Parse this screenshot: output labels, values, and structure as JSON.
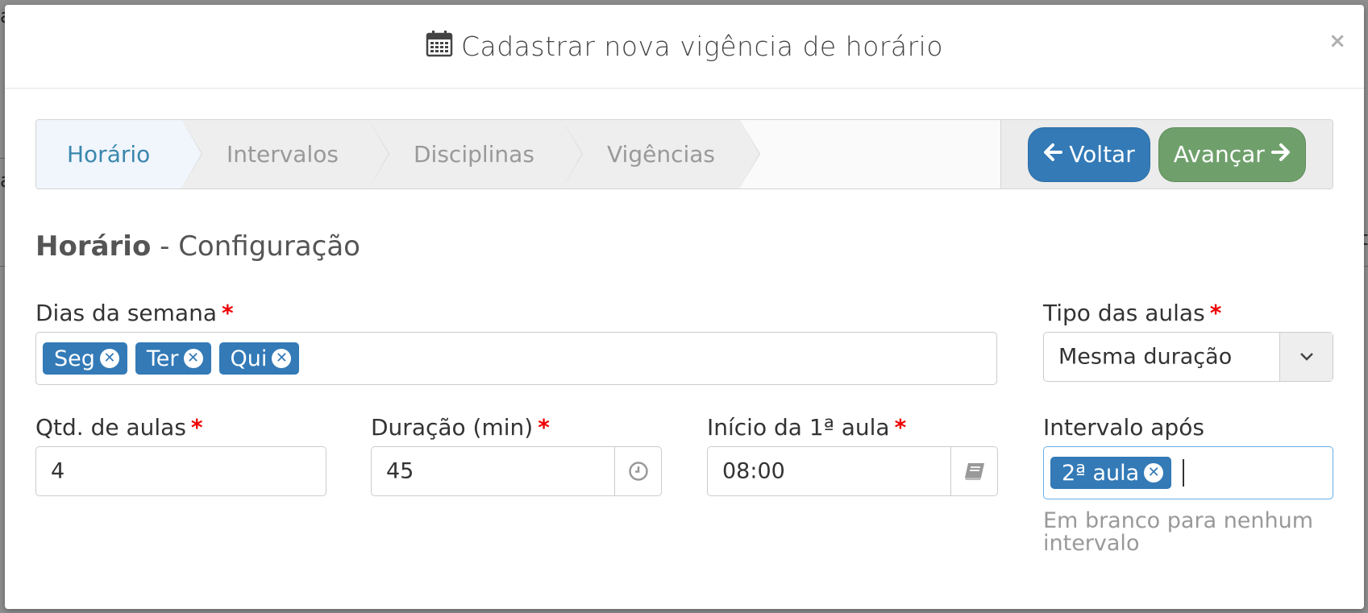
{
  "modal": {
    "title": "Cadastrar nova vigência de horário",
    "title_icon": "calendar-icon",
    "close_label": "×"
  },
  "wizard": {
    "steps": [
      {
        "label": "Horário",
        "active": true
      },
      {
        "label": "Intervalos",
        "active": false
      },
      {
        "label": "Disciplinas",
        "active": false
      },
      {
        "label": "Vigências",
        "active": false
      }
    ],
    "back_label": "Voltar",
    "next_label": "Avançar",
    "back_icon": "arrow-left-icon",
    "next_icon": "arrow-right-icon"
  },
  "section": {
    "title_bold": "Horário",
    "title_rest": " - Configuração"
  },
  "form": {
    "days": {
      "label": "Dias da semana",
      "required": "*",
      "tags": [
        "Seg",
        "Ter",
        "Qui"
      ]
    },
    "lesson_type": {
      "label": "Tipo das aulas",
      "required": "*",
      "value": "Mesma duração"
    },
    "lesson_count": {
      "label": "Qtd. de aulas",
      "required": "*",
      "value": "4"
    },
    "duration": {
      "label": "Duração (min)",
      "required": "*",
      "value": "45",
      "icon": "clock-icon"
    },
    "first_start": {
      "label": "Início da 1ª aula",
      "required": "*",
      "value": "08:00",
      "icon": "book-icon"
    },
    "interval_after": {
      "label": "Intervalo após",
      "tags": [
        "2ª aula"
      ],
      "help": "Em branco para nenhum intervalo"
    }
  },
  "colors": {
    "primary": "#337ab7",
    "success": "#6fa06c",
    "required": "#ee0000"
  }
}
